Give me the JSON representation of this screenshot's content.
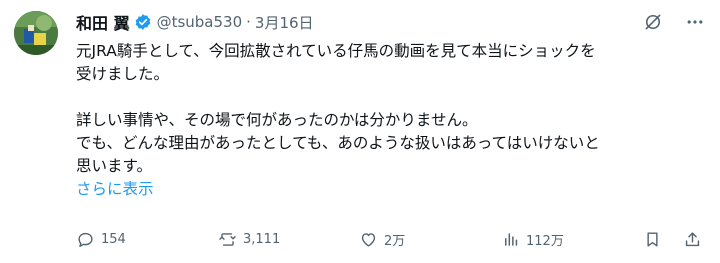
{
  "author": {
    "name": "和田 翼",
    "handle": "@tsuba530",
    "separator": "·",
    "date": "3月16日"
  },
  "post": {
    "line1": "元JRA騎手として、今回拡散されている仔馬の動画を見て本当にショックを",
    "line2": "受けました。",
    "line3": "詳しい事情や、その場で何があったのかは分かりません。",
    "line4": "でも、どんな理由があったとしても、あのような扱いはあってはいけないと",
    "line5": "思います。",
    "show_more": "さらに表示"
  },
  "actions": {
    "replies": "154",
    "reposts": "3,111",
    "likes": "2万",
    "views": "112万"
  },
  "colors": {
    "accent": "#1d9bf0",
    "muted": "#536471",
    "text": "#0f1419"
  },
  "icons": [
    "verified-badge-icon",
    "grok-icon",
    "more-icon",
    "reply-icon",
    "repost-icon",
    "like-icon",
    "views-icon",
    "bookmark-icon",
    "share-icon"
  ]
}
